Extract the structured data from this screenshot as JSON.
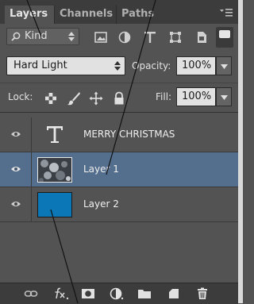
{
  "tabs": [
    {
      "label": "Layers",
      "active": true
    },
    {
      "label": "Channels",
      "active": false
    },
    {
      "label": "Paths",
      "active": false
    }
  ],
  "filter": {
    "kind_label": "Kind"
  },
  "blend": {
    "mode": "Hard Light",
    "opacity_label": "Opacity:",
    "opacity_value": "100%"
  },
  "lock": {
    "label": "Lock:",
    "fill_label": "Fill:",
    "fill_value": "100%"
  },
  "layers": [
    {
      "name": "MERRY CHRISTMAS",
      "type": "text",
      "selected": false
    },
    {
      "name": "Layer 1",
      "type": "image",
      "selected": true
    },
    {
      "name": "Layer 2",
      "type": "fill",
      "selected": false,
      "color": "#0b77b6"
    }
  ],
  "colors": {
    "panel": "#535353",
    "selection": "#546e8e",
    "layer2_fill": "#0b77b6"
  }
}
